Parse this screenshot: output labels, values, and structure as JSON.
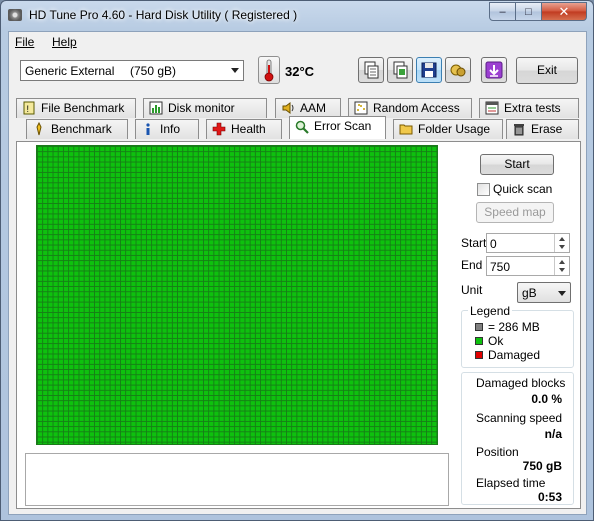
{
  "window": {
    "title": "HD Tune Pro 4.60 - Hard Disk Utility (  Registered )",
    "minimize_glyph": "–",
    "maximize_glyph": "□",
    "close_glyph": "✕"
  },
  "menu": {
    "file": "File",
    "help": "Help"
  },
  "toolbar": {
    "drive_name": "Generic External",
    "drive_capacity": "(750 gB)",
    "temperature": "32°C",
    "exit_label": "Exit",
    "icons": [
      "copy-icon",
      "copy-text-icon",
      "save-icon",
      "screenshot-icon",
      "download-icon",
      "thermometer-icon"
    ]
  },
  "tabs_top": [
    {
      "label": "File Benchmark",
      "icon": "file-benchmark-icon"
    },
    {
      "label": "Disk monitor",
      "icon": "disk-monitor-icon"
    },
    {
      "label": "AAM",
      "icon": "speaker-icon"
    },
    {
      "label": "Random Access",
      "icon": "random-access-icon"
    },
    {
      "label": "Extra tests",
      "icon": "extra-tests-icon"
    }
  ],
  "tabs_bottom": [
    {
      "label": "Benchmark",
      "icon": "benchmark-icon"
    },
    {
      "label": "Info",
      "icon": "info-icon"
    },
    {
      "label": "Health",
      "icon": "health-icon"
    },
    {
      "label": "Error Scan",
      "icon": "magnifier-icon",
      "selected": true
    },
    {
      "label": "Folder Usage",
      "icon": "folder-icon"
    },
    {
      "label": "Erase",
      "icon": "trash-icon"
    }
  ],
  "scan": {
    "scan_progress": 1.0,
    "status_colors": {
      "ok": "#0ec10e",
      "damaged": "#e00000",
      "block": "#808080"
    }
  },
  "controls": {
    "start_button": "Start",
    "quick_scan_label": "Quick scan",
    "quick_scan_checked": false,
    "speed_map_button": "Speed map",
    "start_label": "Start",
    "start_value": "0",
    "end_label": "End",
    "end_value": "750",
    "unit_label": "Unit",
    "unit_value": "gB"
  },
  "legend": {
    "title": "Legend",
    "block_size": "= 286 MB",
    "ok": "Ok",
    "damaged": "Damaged"
  },
  "stats": {
    "damaged_blocks_label": "Damaged blocks",
    "damaged_blocks_value": "0.0 %",
    "scanning_speed_label": "Scanning speed",
    "scanning_speed_value": "n/a",
    "position_label": "Position",
    "position_value": "750 gB",
    "elapsed_label": "Elapsed time",
    "elapsed_value": "0:53"
  }
}
